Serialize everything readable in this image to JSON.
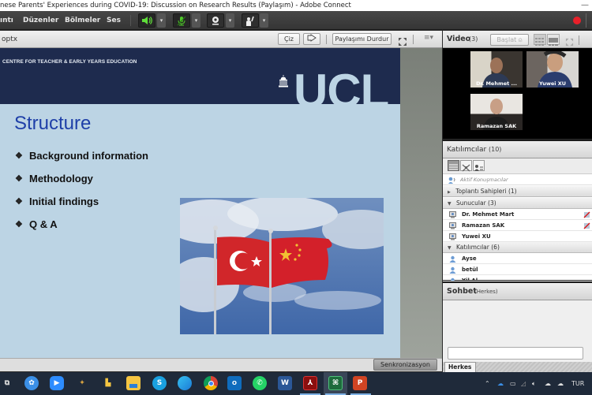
{
  "window": {
    "title": "nese Parents' Experiences during COVID-19: Discussion on Research Results (Paylaşım) - Adobe Connect",
    "minimize_icon": "minimize-icon"
  },
  "menubar": {
    "items": [
      "ıntı",
      "Düzenler",
      "Bölmeler",
      "Ses"
    ],
    "controls": [
      {
        "name": "speaker",
        "icon": "speaker-icon",
        "state": "on"
      },
      {
        "name": "microphone",
        "icon": "microphone-muted-icon",
        "state": "muted"
      },
      {
        "name": "camera",
        "icon": "webcam-icon",
        "state": "off"
      },
      {
        "name": "raise-hand",
        "icon": "raise-hand-icon",
        "state": "off"
      }
    ],
    "recording_indicator_color": "#e8202a"
  },
  "share_pod": {
    "file_name": "optx",
    "draw_button": "Çiz",
    "pointer_button_icon": "pointer-icon",
    "stop_sharing_button": "Paylaşımı Durdur",
    "fullscreen_icon": "fullscreen-icon",
    "menu_icon": "pod-menu-icon",
    "sync_button": "Senkronizasyon"
  },
  "slide": {
    "header": "CENTRE FOR TEACHER & EARLY YEARS EDUCATION",
    "logo": "UCL",
    "title": "Structure",
    "bullets": [
      "Background information",
      "Methodology",
      "Initial findings",
      "Q & A"
    ],
    "bullet_glyph": "❖",
    "image_alt": "Turkish and Chinese flags on poles against a cloudy blue sky",
    "colors": {
      "banner": "#1e2b4e",
      "background": "#bcd4e4",
      "title": "#1e3fa8"
    }
  },
  "video_pod": {
    "title": "Video",
    "count": "(3)",
    "start_button": "Başlat",
    "participants": [
      "Dr. Mehmet ...",
      "Yuwei XU",
      "Ramazan SAK"
    ]
  },
  "attendees_pod": {
    "title": "Katılımcılar",
    "count": "(10)",
    "active_speakers_label": "Aktif Konuşmacılar",
    "groups": [
      {
        "label": "Toplantı Sahipleri (1)",
        "expanded": false,
        "members": []
      },
      {
        "label": "Sunucular (3)",
        "expanded": true,
        "members": [
          "Dr. Mehmet Mart",
          "Ramazan SAK",
          "Yuwei XU"
        ]
      },
      {
        "label": "Katılımcılar (6)",
        "expanded": true,
        "members": [
          "Ayse",
          "betül",
          "Yil Al"
        ]
      }
    ]
  },
  "chat_pod": {
    "title": "Sohbet",
    "scope": "(Herkes)",
    "input_value": "",
    "tab_label": "Herkes"
  },
  "taskbar": {
    "apps": [
      "task-view",
      "app-blue-circle",
      "zoom",
      "paint-tool",
      "onedrive-files",
      "file-explorer",
      "skype",
      "edge",
      "chrome",
      "outlook",
      "whatsapp",
      "word",
      "acrobat",
      "excel",
      "powerpoint"
    ],
    "tray": {
      "language": "TUR"
    }
  }
}
